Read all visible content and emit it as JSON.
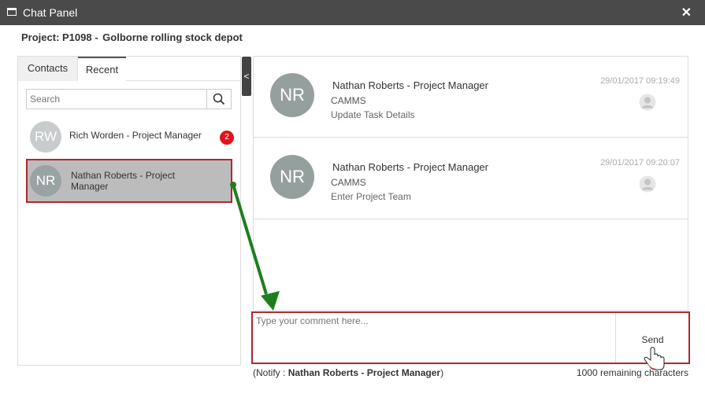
{
  "window": {
    "title": "Chat Panel",
    "close_glyph": "✕"
  },
  "project": {
    "id_label": "Project: P1098 -",
    "name": "Golborne rolling stock depot"
  },
  "tabs": [
    {
      "label": "Contacts"
    },
    {
      "label": "Recent"
    }
  ],
  "search": {
    "placeholder": "Search"
  },
  "contacts": [
    {
      "initials": "RW",
      "name": "Rich Worden - Project Manager",
      "unread": "2"
    },
    {
      "initials": "NR",
      "name_line1": "Nathan Roberts - Project",
      "name_line2": "Manager"
    }
  ],
  "collapse_glyph": "<",
  "messages": [
    {
      "initials": "NR",
      "name": "Nathan Roberts - Project Manager",
      "source": "CAMMS",
      "text": "Update Task Details",
      "time": "29/01/2017 09:19:49"
    },
    {
      "initials": "NR",
      "name": "Nathan Roberts - Project Manager",
      "source": "CAMMS",
      "text": "Enter Project Team",
      "time": "29/01/2017 09:20:07"
    }
  ],
  "compose": {
    "placeholder": "Type your comment here...",
    "send_label": "Send"
  },
  "notify": {
    "prefix": "(Notify :",
    "name": "Nathan Roberts - Project Manager",
    "suffix": ")"
  },
  "remaining": "1000 remaining characters",
  "colors": {
    "titlebar": "#4a4a4a",
    "highlight_border": "#b0282d",
    "badge": "#e0141e",
    "arrow": "#1e7e1e"
  },
  "icons": [
    "window-icon",
    "close-icon",
    "search-icon",
    "person-icon",
    "hand-cursor-icon"
  ]
}
